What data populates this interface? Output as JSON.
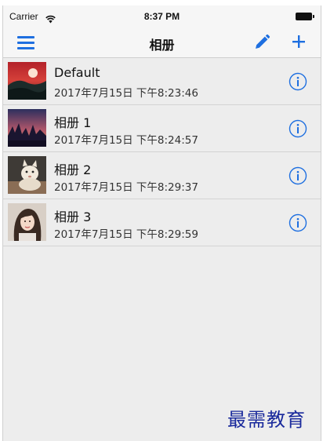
{
  "status_bar": {
    "carrier": "Carrier",
    "time": "8:37 PM"
  },
  "nav": {
    "title": "相册",
    "accent_color": "#1e6fe0"
  },
  "albums": [
    {
      "title": "Default",
      "date": "2017年7月15日 下午8:23:46"
    },
    {
      "title": "相册 1",
      "date": "2017年7月15日 下午8:24:57"
    },
    {
      "title": "相册 2",
      "date": "2017年7月15日 下午8:29:37"
    },
    {
      "title": "相册 3",
      "date": "2017年7月15日 下午8:29:59"
    }
  ],
  "icons": {
    "menu": "hamburger-menu-icon",
    "edit": "pencil-icon",
    "add": "plus-icon",
    "info": "info-circle-icon",
    "wifi": "wifi-icon",
    "battery": "battery-icon"
  },
  "watermark": "最需教育"
}
